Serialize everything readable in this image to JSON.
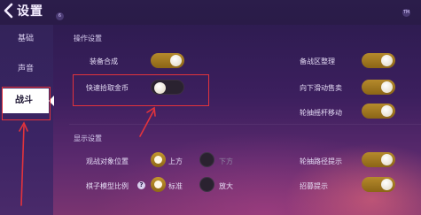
{
  "header": {
    "title": "设置",
    "corner_badges": [
      "6",
      "TM"
    ]
  },
  "sidebar": {
    "items": [
      {
        "label": "基础",
        "active": false
      },
      {
        "label": "声音",
        "active": false
      },
      {
        "label": "战斗",
        "active": true
      }
    ]
  },
  "sections": {
    "operation": {
      "title": "操作设置",
      "equipment_synthesis": {
        "label": "装备合成",
        "on": true
      },
      "quick_pickup_coins": {
        "label": "快速拾取金币",
        "on": false
      },
      "bench_organize": {
        "label": "备战区整理",
        "on": true
      },
      "swipe_down_sell": {
        "label": "向下滑动售卖",
        "on": true
      },
      "wheel_joystick_move": {
        "label": "轮抽摇杆移动",
        "on": true
      }
    },
    "display": {
      "title": "显示设置",
      "spectate_position": {
        "label": "观战对象位置",
        "options": [
          "上方",
          "下方"
        ],
        "selected": "上方"
      },
      "piece_model_scale": {
        "label": "棋子模型比例",
        "options": [
          "标准",
          "放大"
        ],
        "selected": "标准"
      },
      "wheel_path_hint": {
        "label": "轮抽路径提示",
        "on": true
      },
      "recruit_hint": {
        "label": "招募提示",
        "on": true
      }
    }
  },
  "colors": {
    "accent_gold": "#b58a2c",
    "highlight_red": "#e2333c",
    "sidebar_active": "#ffffff"
  }
}
